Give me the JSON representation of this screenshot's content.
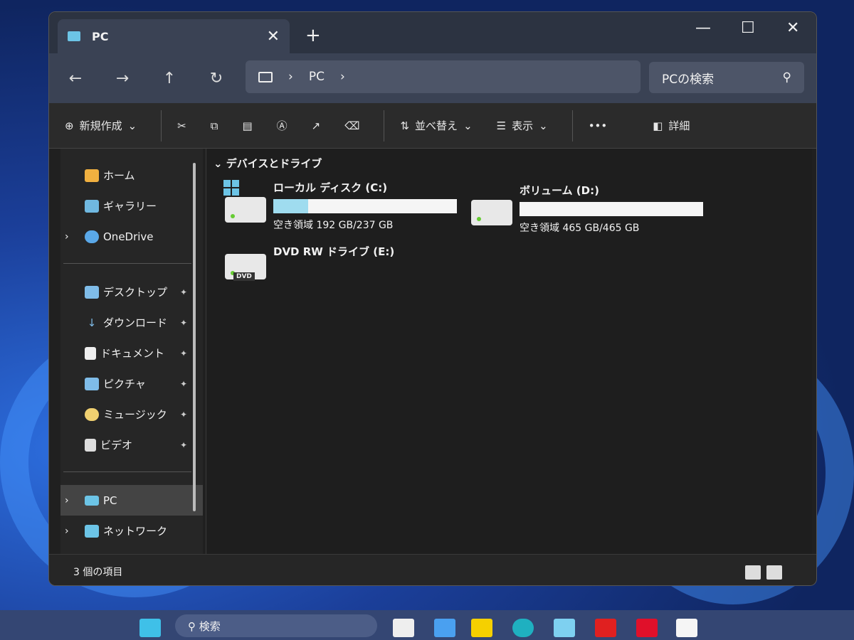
{
  "window": {
    "tab_title": "PC",
    "new_tab": "+",
    "minimize": "—",
    "maximize": "☐",
    "close": "✕"
  },
  "nav": {
    "back": "←",
    "forward": "→",
    "up": "↑",
    "refresh": "↻",
    "breadcrumb": [
      "PC"
    ],
    "search_placeholder": "PCの検索"
  },
  "commands": {
    "new": "新規作成",
    "sort": "並べ替え",
    "view": "表示",
    "more": "•••",
    "details": "詳細"
  },
  "sidebar": {
    "items": [
      {
        "label": "ホーム",
        "color": "#f0b040"
      },
      {
        "label": "ギャラリー",
        "color": "#70b8e0"
      },
      {
        "label": "OneDrive",
        "color": "#5aa8e8"
      }
    ],
    "pinned": [
      {
        "label": "デスクトップ",
        "color": "#7fbce8"
      },
      {
        "label": "ダウンロード",
        "color": "#7fbce8"
      },
      {
        "label": "ドキュメント",
        "color": "#eeeeee"
      },
      {
        "label": "ピクチャ",
        "color": "#7fbce8"
      },
      {
        "label": "ミュージック",
        "color": "#f0d070"
      },
      {
        "label": "ビデオ",
        "color": "#dddddd"
      }
    ],
    "bottom": [
      {
        "label": "PC",
        "color": "#6cc4e6"
      },
      {
        "label": "ネットワーク",
        "color": "#6cc4e6"
      }
    ]
  },
  "content": {
    "group": "デバイスとドライブ",
    "drives": [
      {
        "name": "ローカル ディスク (C:)",
        "free": "空き領域 192 GB/237 GB",
        "used_fraction": 0.19
      },
      {
        "name": "ボリューム (D:)",
        "free": "空き領域 465 GB/465 GB",
        "used_fraction": 0.0
      },
      {
        "name": "DVD RW ドライブ (E:)",
        "badge": "DVD"
      }
    ]
  },
  "status": {
    "count": "3 個の項目"
  },
  "taskbar": {
    "search": "検索"
  }
}
